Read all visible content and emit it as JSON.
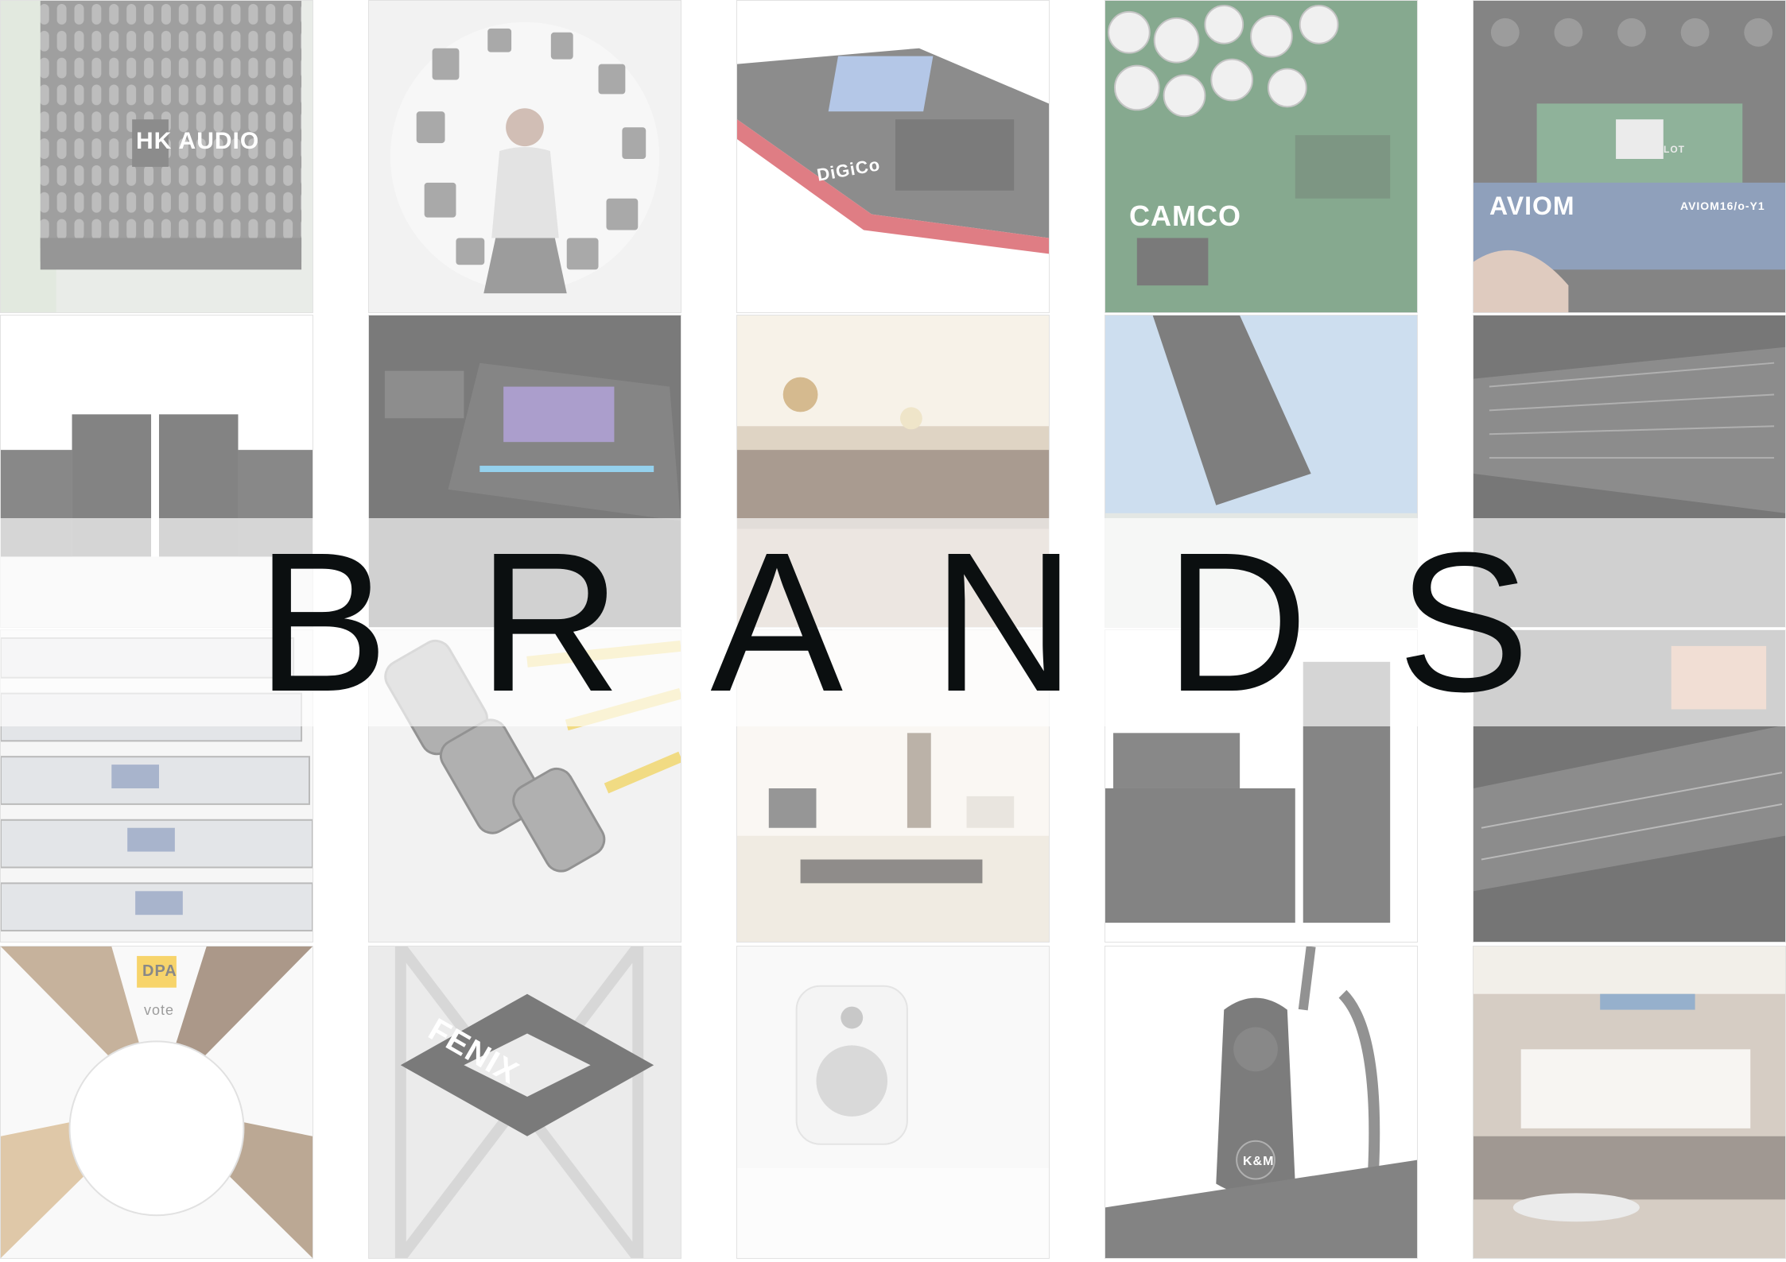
{
  "page": {
    "title": "BRANDS"
  },
  "tiles": [
    {
      "name": "hk-audio-speaker",
      "brand_label": "HK AUDIO"
    },
    {
      "name": "speaker-sphere-portrait",
      "brand_label": ""
    },
    {
      "name": "digico-console",
      "brand_label": "DiGiCo"
    },
    {
      "name": "camco-amplifier-board",
      "brand_label": "CAMCO"
    },
    {
      "name": "aviom-card",
      "brand_label": "AVIOM",
      "model_label": "AVIOM16/o-Y1",
      "slot_label": "SLOT"
    },
    {
      "name": "subwoofer-array",
      "brand_label": ""
    },
    {
      "name": "allen-heath-console",
      "brand_label": ""
    },
    {
      "name": "bar-interior",
      "brand_label": ""
    },
    {
      "name": "line-array-outdoor",
      "brand_label": ""
    },
    {
      "name": "large-mixing-console",
      "brand_label": ""
    },
    {
      "name": "rme-interfaces",
      "brand_label": ""
    },
    {
      "name": "neutrik-xlr-cables",
      "brand_label": ""
    },
    {
      "name": "listening-room",
      "brand_label": ""
    },
    {
      "name": "white-line-array",
      "brand_label": ""
    },
    {
      "name": "concert-stage-console",
      "brand_label": ""
    },
    {
      "name": "dpa-microphones",
      "brand_label": "DPA",
      "product_label": "vote"
    },
    {
      "name": "truss-system",
      "brand_label": "FENIX"
    },
    {
      "name": "genelec-monitor",
      "brand_label": ""
    },
    {
      "name": "km-mic-clamp",
      "brand_label": "K&M"
    },
    {
      "name": "acoustic-living-room",
      "brand_label": ""
    }
  ],
  "colors": {
    "title": "#0b0f10",
    "banner": "#ffffff",
    "console_red": "#c8202b",
    "board_green": "#2f6b3e",
    "aviom_blue": "#3f5c8a",
    "cable_yellow": "#e7c22a",
    "dpa_yellow": "#f1b500"
  }
}
